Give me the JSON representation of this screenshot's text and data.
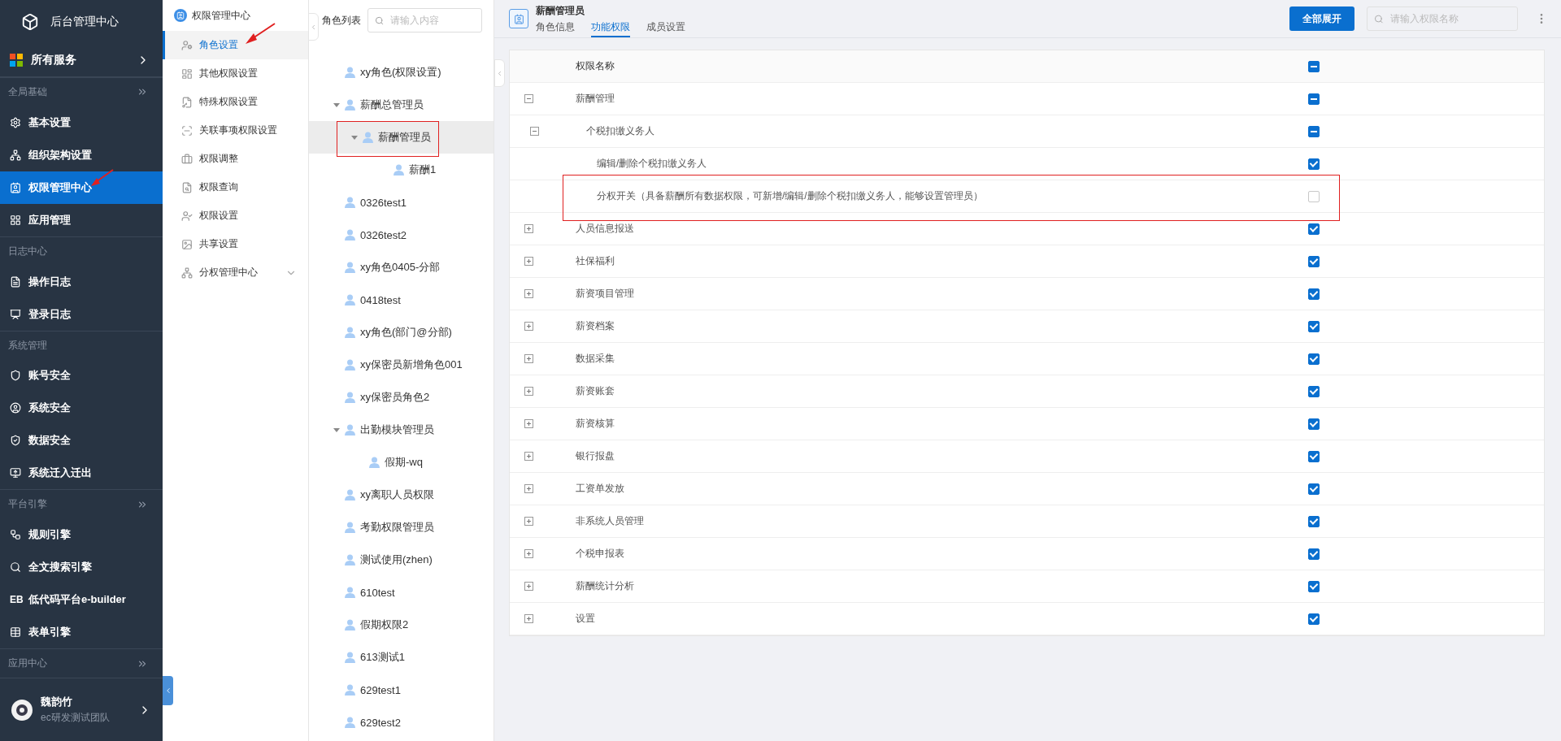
{
  "sidebar": {
    "title": "后台管理中心",
    "all_services": "所有服务",
    "sections": [
      {
        "title": "全局基础",
        "collapsible": true,
        "items": [
          {
            "label": "基本设置",
            "selected": false
          },
          {
            "label": "组织架构设置",
            "selected": false
          },
          {
            "label": "权限管理中心",
            "selected": true
          },
          {
            "label": "应用管理",
            "selected": false
          }
        ]
      },
      {
        "title": "日志中心",
        "collapsible": false,
        "items": [
          {
            "label": "操作日志",
            "selected": false
          },
          {
            "label": "登录日志",
            "selected": false
          }
        ]
      },
      {
        "title": "系统管理",
        "collapsible": false,
        "items": [
          {
            "label": "账号安全",
            "selected": false
          },
          {
            "label": "系统安全",
            "selected": false
          },
          {
            "label": "数据安全",
            "selected": false
          },
          {
            "label": "系统迁入迁出",
            "selected": false
          }
        ]
      },
      {
        "title": "平台引擎",
        "collapsible": true,
        "items": [
          {
            "label": "规则引擎",
            "selected": false
          },
          {
            "label": "全文搜索引擎",
            "selected": false
          },
          {
            "label": "低代码平台e-builder",
            "selected": false,
            "icon_text": "EB"
          },
          {
            "label": "表单引擎",
            "selected": false
          }
        ]
      },
      {
        "title": "应用中心",
        "collapsible": true
      }
    ],
    "user": {
      "name": "魏韵竹",
      "team": "ec研发测试团队"
    }
  },
  "subnav": {
    "title": "权限管理中心",
    "items": [
      {
        "label": "角色设置",
        "selected": true
      },
      {
        "label": "其他权限设置",
        "selected": false
      },
      {
        "label": "特殊权限设置",
        "selected": false
      },
      {
        "label": "关联事项权限设置",
        "selected": false
      },
      {
        "label": "权限调整",
        "selected": false
      },
      {
        "label": "权限查询",
        "selected": false
      },
      {
        "label": "权限设置",
        "selected": false
      },
      {
        "label": "共享设置",
        "selected": false
      },
      {
        "label": "分权管理中心",
        "selected": false,
        "expanded": false
      }
    ]
  },
  "role_list": {
    "title": "角色列表",
    "search": {
      "placeholder": "请输入内容"
    },
    "roles": [
      {
        "name": "xy角色(权限设置)",
        "selected": false
      },
      {
        "name": "薪酬总管理员",
        "selected": false,
        "expanded": true,
        "children": [
          {
            "name": "薪酬管理员",
            "selected": true,
            "expanded": true,
            "children": [
              {
                "name": "薪酬1",
                "selected": false
              }
            ]
          }
        ]
      },
      {
        "name": "0326test1",
        "selected": false
      },
      {
        "name": "0326test2",
        "selected": false
      },
      {
        "name": "xy角色0405-分部",
        "selected": false
      },
      {
        "name": "0418test",
        "selected": false
      },
      {
        "name": "xy角色(部门@分部)",
        "selected": false
      },
      {
        "name": "xy保密员新增角色001",
        "selected": false
      },
      {
        "name": "xy保密员角色2",
        "selected": false
      },
      {
        "name": "出勤模块管理员",
        "selected": false,
        "expanded": true,
        "children": [
          {
            "name": "假期-wq",
            "selected": false
          }
        ]
      },
      {
        "name": "xy离职人员权限",
        "selected": false
      },
      {
        "name": "考勤权限管理员",
        "selected": false
      },
      {
        "name": "测试使用(zhen)",
        "selected": false
      },
      {
        "name": "610test",
        "selected": false
      },
      {
        "name": "假期权限2",
        "selected": false
      },
      {
        "name": "613测试1",
        "selected": false
      },
      {
        "name": "629test1",
        "selected": false
      },
      {
        "name": "629test2",
        "selected": false
      }
    ]
  },
  "detail": {
    "title": "薪酬管理员",
    "tabs": [
      {
        "label": "角色信息",
        "selected": false
      },
      {
        "label": "功能权限",
        "selected": true
      },
      {
        "label": "成员设置",
        "selected": false
      }
    ],
    "expand_all": "全部展开",
    "search": {
      "placeholder": "请输入权限名称"
    },
    "table": {
      "column": "权限名称",
      "header_checked": true,
      "header_indeterminate": true,
      "rows": [
        {
          "name": "薪酬管理",
          "checked": true,
          "indeterminate": true,
          "expanded": true,
          "children": [
            {
              "name": "个税扣缴义务人",
              "checked": true,
              "indeterminate": true,
              "expanded": true,
              "children": [
                {
                  "name": "编辑/删除个税扣缴义务人",
                  "checked": true
                },
                {
                  "name": "分权开关（具备薪酬所有数据权限，可新增/编辑/删除个税扣缴义务人，能够设置管理员）",
                  "checked": false
                }
              ]
            }
          ]
        },
        {
          "name": "人员信息报送",
          "checked": true,
          "expanded": false
        },
        {
          "name": "社保福利",
          "checked": true,
          "expanded": false
        },
        {
          "name": "薪资项目管理",
          "checked": true,
          "expanded": false
        },
        {
          "name": "薪资档案",
          "checked": true,
          "expanded": false
        },
        {
          "name": "数据采集",
          "checked": true,
          "expanded": false
        },
        {
          "name": "薪资账套",
          "checked": true,
          "expanded": false
        },
        {
          "name": "薪资核算",
          "checked": true,
          "expanded": false
        },
        {
          "name": "银行报盘",
          "checked": true,
          "expanded": false
        },
        {
          "name": "工资单发放",
          "checked": true,
          "expanded": false
        },
        {
          "name": "非系统人员管理",
          "checked": true,
          "expanded": false
        },
        {
          "name": "个税申报表",
          "checked": true,
          "expanded": false
        },
        {
          "name": "薪酬统计分析",
          "checked": true,
          "expanded": false
        },
        {
          "name": "设置",
          "checked": true,
          "expanded": false
        }
      ]
    }
  }
}
